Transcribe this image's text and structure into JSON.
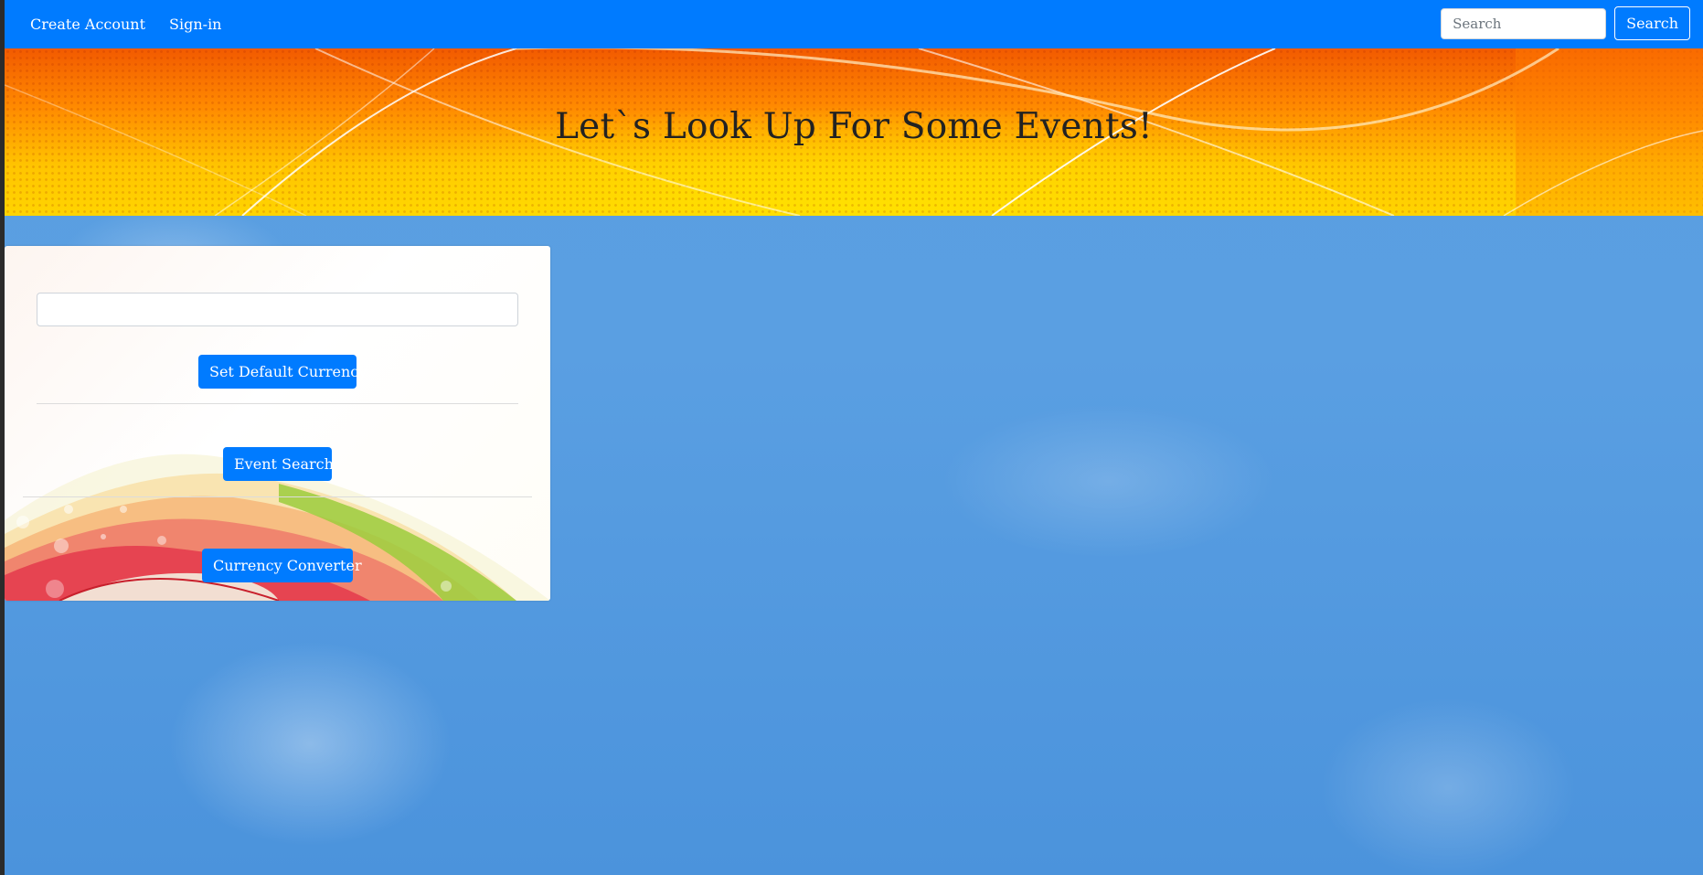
{
  "navbar": {
    "links": [
      {
        "label": "Create Account"
      },
      {
        "label": "Sign-in"
      }
    ],
    "search": {
      "placeholder": "Search",
      "button_label": "Search"
    }
  },
  "hero": {
    "title": "Let`s Look Up For Some Events!"
  },
  "card": {
    "currency_input_value": "",
    "set_default_currency_label": "Set Default Currency",
    "event_search_label": "Event Search",
    "currency_converter_label": "Currency Converter"
  },
  "colors": {
    "primary": "#007bff",
    "sky": "#5a9ee0",
    "hero_orange": "#ff8a00",
    "hero_yellow": "#ffd400"
  }
}
